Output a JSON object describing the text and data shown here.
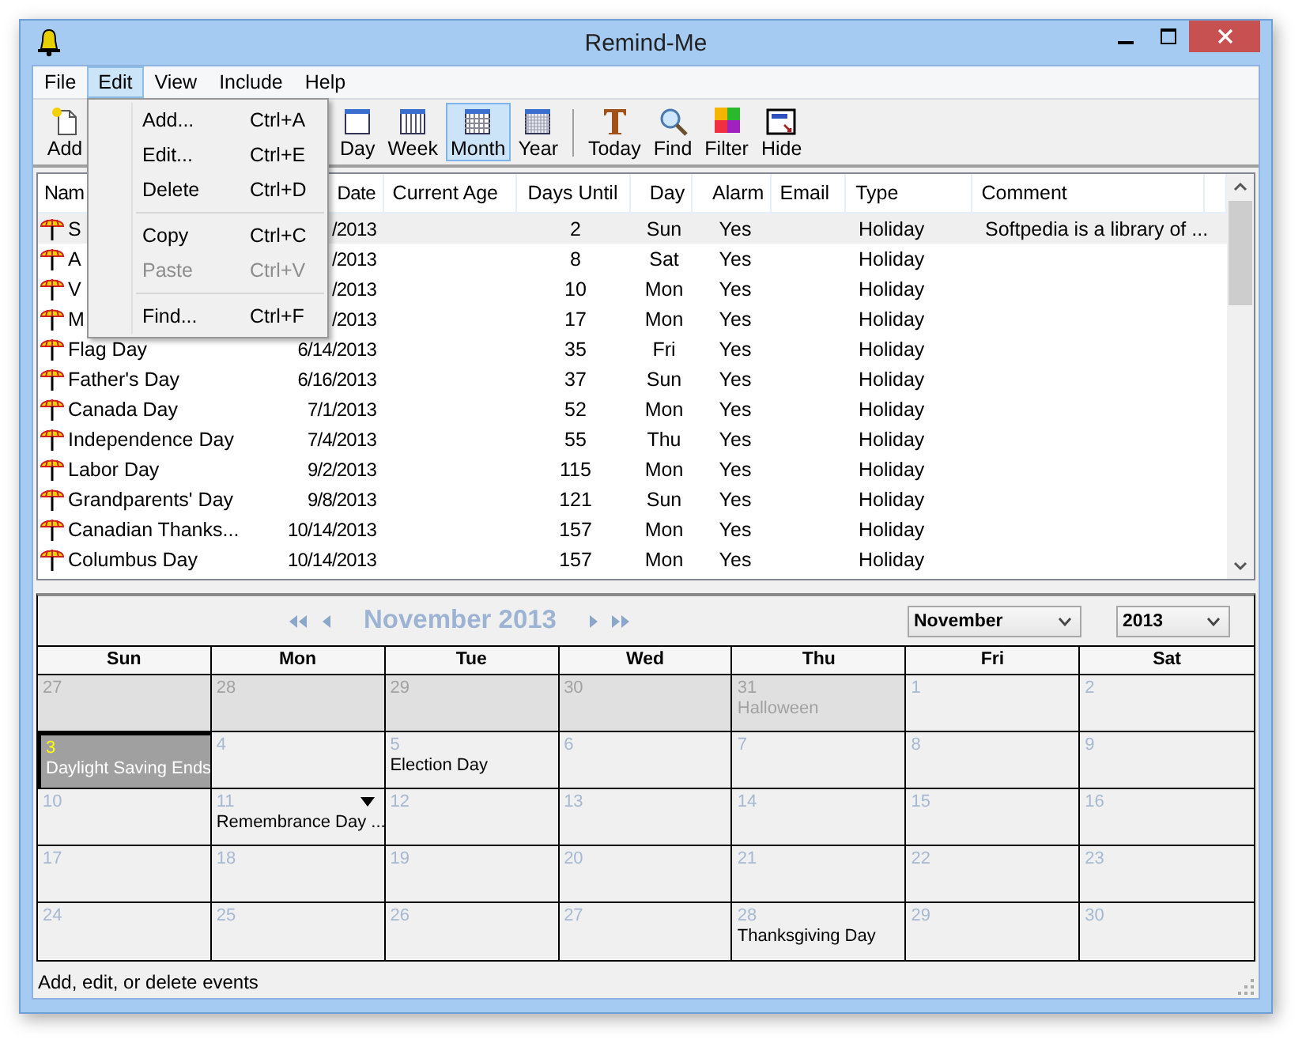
{
  "window": {
    "title": "Remind-Me"
  },
  "menu_bar": [
    {
      "label": "File",
      "selected": false
    },
    {
      "label": "Edit",
      "selected": true
    },
    {
      "label": "View",
      "selected": false
    },
    {
      "label": "Include",
      "selected": false
    },
    {
      "label": "Help",
      "selected": false
    }
  ],
  "toolbar": [
    {
      "label": "Add",
      "kind": "new",
      "selected": false
    },
    {
      "label": "Day",
      "kind": "day",
      "selected": false
    },
    {
      "label": "Week",
      "kind": "week",
      "selected": false
    },
    {
      "label": "Month",
      "kind": "month",
      "selected": true
    },
    {
      "label": "Year",
      "kind": "year",
      "selected": false
    },
    {
      "kind": "separator"
    },
    {
      "label": "Today",
      "kind": "today",
      "selected": false
    },
    {
      "label": "Find",
      "kind": "find",
      "selected": false
    },
    {
      "label": "Filter",
      "kind": "filter",
      "selected": false
    },
    {
      "label": "Hide",
      "kind": "hide",
      "selected": false
    }
  ],
  "edit_menu": {
    "items": [
      {
        "kind": "item",
        "label": "Add...",
        "shortcut": "Ctrl+A",
        "disabled": false
      },
      {
        "kind": "item",
        "label": "Edit...",
        "shortcut": "Ctrl+E",
        "disabled": false
      },
      {
        "kind": "item",
        "label": "Delete",
        "shortcut": "Ctrl+D",
        "disabled": false
      },
      {
        "kind": "separator"
      },
      {
        "kind": "item",
        "label": "Copy",
        "shortcut": "Ctrl+C",
        "disabled": false
      },
      {
        "kind": "item",
        "label": "Paste",
        "shortcut": "Ctrl+V",
        "disabled": true
      },
      {
        "kind": "separator"
      },
      {
        "kind": "item",
        "label": "Find...",
        "shortcut": "Ctrl+F",
        "disabled": false
      }
    ]
  },
  "table": {
    "columns": [
      "Nam",
      "Date",
      "Current Age",
      "Days Until",
      "Day",
      "Alarm",
      "Email",
      "Type",
      "Comment"
    ],
    "rows": [
      {
        "name": "S",
        "date": "/2013",
        "days_until": "2",
        "day": "Sun",
        "alarm": "Yes",
        "type": "Holiday",
        "comment": "Softpedia is a library of ...",
        "selected": true
      },
      {
        "name": "A",
        "date": "/2013",
        "days_until": "8",
        "day": "Sat",
        "alarm": "Yes",
        "type": "Holiday",
        "selected": false
      },
      {
        "name": "V",
        "date": "/2013",
        "days_until": "10",
        "day": "Mon",
        "alarm": "Yes",
        "type": "Holiday",
        "selected": false
      },
      {
        "name": "M",
        "date": "/2013",
        "days_until": "17",
        "day": "Mon",
        "alarm": "Yes",
        "type": "Holiday",
        "selected": false
      },
      {
        "name": "Flag Day",
        "date": "6/14/2013",
        "days_until": "35",
        "day": "Fri",
        "alarm": "Yes",
        "type": "Holiday",
        "selected": false
      },
      {
        "name": "Father's Day",
        "date": "6/16/2013",
        "days_until": "37",
        "day": "Sun",
        "alarm": "Yes",
        "type": "Holiday",
        "selected": false
      },
      {
        "name": "Canada Day",
        "date": "7/1/2013",
        "days_until": "52",
        "day": "Mon",
        "alarm": "Yes",
        "type": "Holiday",
        "selected": false
      },
      {
        "name": "Independence Day",
        "date": "7/4/2013",
        "days_until": "55",
        "day": "Thu",
        "alarm": "Yes",
        "type": "Holiday",
        "selected": false
      },
      {
        "name": "Labor Day",
        "date": "9/2/2013",
        "days_until": "115",
        "day": "Mon",
        "alarm": "Yes",
        "type": "Holiday",
        "selected": false
      },
      {
        "name": "Grandparents' Day",
        "date": "9/8/2013",
        "days_until": "121",
        "day": "Sun",
        "alarm": "Yes",
        "type": "Holiday",
        "selected": false
      },
      {
        "name": "Canadian Thanks...",
        "date": "10/14/2013",
        "days_until": "157",
        "day": "Mon",
        "alarm": "Yes",
        "type": "Holiday",
        "selected": false
      },
      {
        "name": "Columbus Day",
        "date": "10/14/2013",
        "days_until": "157",
        "day": "Mon",
        "alarm": "Yes",
        "type": "Holiday",
        "selected": false
      }
    ]
  },
  "calendar": {
    "title": "November 2013",
    "month_select": "November",
    "year_select": "2013",
    "weekdays": [
      "Sun",
      "Mon",
      "Tue",
      "Wed",
      "Thu",
      "Fri",
      "Sat"
    ],
    "weeks": [
      {
        "days": [
          {
            "day": "27",
            "in_month": false,
            "selected": false,
            "more": false
          },
          {
            "day": "28",
            "in_month": false,
            "selected": false,
            "more": false
          },
          {
            "day": "29",
            "in_month": false,
            "selected": false,
            "more": false
          },
          {
            "day": "30",
            "in_month": false,
            "selected": false,
            "more": false
          },
          {
            "day": "31",
            "in_month": false,
            "selected": false,
            "more": false,
            "event": "Halloween"
          },
          {
            "day": "1",
            "in_month": true,
            "selected": false,
            "more": false
          },
          {
            "day": "2",
            "in_month": true,
            "selected": false,
            "more": false
          }
        ]
      },
      {
        "days": [
          {
            "day": "3",
            "in_month": true,
            "selected": true,
            "more": false,
            "event": "Daylight Saving Ends"
          },
          {
            "day": "4",
            "in_month": true,
            "selected": false,
            "more": false
          },
          {
            "day": "5",
            "in_month": true,
            "selected": false,
            "more": false,
            "event": "Election Day"
          },
          {
            "day": "6",
            "in_month": true,
            "selected": false,
            "more": false
          },
          {
            "day": "7",
            "in_month": true,
            "selected": false,
            "more": false
          },
          {
            "day": "8",
            "in_month": true,
            "selected": false,
            "more": false
          },
          {
            "day": "9",
            "in_month": true,
            "selected": false,
            "more": false
          }
        ]
      },
      {
        "days": [
          {
            "day": "10",
            "in_month": true,
            "selected": false,
            "more": false
          },
          {
            "day": "11",
            "in_month": true,
            "selected": false,
            "more": true,
            "event": "Remembrance Day ..."
          },
          {
            "day": "12",
            "in_month": true,
            "selected": false,
            "more": false
          },
          {
            "day": "13",
            "in_month": true,
            "selected": false,
            "more": false
          },
          {
            "day": "14",
            "in_month": true,
            "selected": false,
            "more": false
          },
          {
            "day": "15",
            "in_month": true,
            "selected": false,
            "more": false
          },
          {
            "day": "16",
            "in_month": true,
            "selected": false,
            "more": false
          }
        ]
      },
      {
        "days": [
          {
            "day": "17",
            "in_month": true,
            "selected": false,
            "more": false
          },
          {
            "day": "18",
            "in_month": true,
            "selected": false,
            "more": false
          },
          {
            "day": "19",
            "in_month": true,
            "selected": false,
            "more": false
          },
          {
            "day": "20",
            "in_month": true,
            "selected": false,
            "more": false
          },
          {
            "day": "21",
            "in_month": true,
            "selected": false,
            "more": false
          },
          {
            "day": "22",
            "in_month": true,
            "selected": false,
            "more": false
          },
          {
            "day": "23",
            "in_month": true,
            "selected": false,
            "more": false
          }
        ]
      },
      {
        "days": [
          {
            "day": "24",
            "in_month": true,
            "selected": false,
            "more": false
          },
          {
            "day": "25",
            "in_month": true,
            "selected": false,
            "more": false
          },
          {
            "day": "26",
            "in_month": true,
            "selected": false,
            "more": false
          },
          {
            "day": "27",
            "in_month": true,
            "selected": false,
            "more": false
          },
          {
            "day": "28",
            "in_month": true,
            "selected": false,
            "more": false,
            "event": "Thanksgiving Day"
          },
          {
            "day": "29",
            "in_month": true,
            "selected": false,
            "more": false
          },
          {
            "day": "30",
            "in_month": true,
            "selected": false,
            "more": false
          }
        ]
      }
    ]
  },
  "status_bar": "Add, edit, or delete events"
}
